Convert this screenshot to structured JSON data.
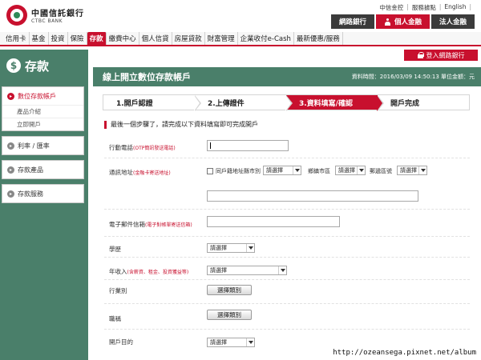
{
  "brand": {
    "name_zh": "中國信託銀行",
    "name_en": "CTBC BANK"
  },
  "util_links": [
    "中信金控",
    "服務據點",
    "English"
  ],
  "brand_tabs": {
    "online_bank": "網路銀行",
    "personal": "個人金融",
    "corporate": "法人金融"
  },
  "main_nav": [
    "信用卡",
    "基金",
    "投資",
    "保險",
    "存款",
    "繳費中心",
    "個人信貸",
    "房屋貸款",
    "財富管理",
    "企業收付e-Cash",
    "最新優惠/服務"
  ],
  "main_nav_active": "存款",
  "login_button": "登入網路銀行",
  "sidebar": {
    "title": "存款",
    "groups": [
      {
        "label": "數位存款帳戶",
        "sub": [
          "產品介紹",
          "立即開戶"
        ]
      },
      {
        "label": "利率 / 匯率",
        "sub": []
      },
      {
        "label": "存款產品",
        "sub": []
      },
      {
        "label": "存款服務",
        "sub": []
      }
    ]
  },
  "content": {
    "title": "線上開立數位存款帳戶",
    "meta": "資料時間：2016/03/09 14:50:13 單位金額：元",
    "steps": [
      "1.開戶認證",
      "2.上傳證件",
      "3.資料填寫/確認",
      "開戶完成"
    ],
    "active_step": 2,
    "notice": "最後一個步驟了，請完成以下資料填寫即可完成開戶"
  },
  "form": {
    "mobile": {
      "label": "行動電話",
      "hint": "(OTP簡訊發送電話)",
      "value": ""
    },
    "address": {
      "label": "通訊地址",
      "hint": "(金融卡寄送地址)",
      "same_as_registered": "同戶籍地址",
      "city_label": "縣市別",
      "district_label": "鄉鎮市區",
      "zip_label": "郵遞區號",
      "select_placeholder": "請選擇",
      "street_value": ""
    },
    "email": {
      "label": "電子郵件信箱",
      "hint": "(電子對帳單寄送信箱)",
      "value": ""
    },
    "education": {
      "label": "學歷",
      "value": "請選擇"
    },
    "income": {
      "label": "年收入",
      "hint": "(含薪資、租金、投資獲益等)",
      "value": "請選擇"
    },
    "industry": {
      "label": "行業別",
      "button": "選擇類別"
    },
    "position": {
      "label": "職稱",
      "button": "選擇類別"
    },
    "purpose": {
      "label": "開戶目的",
      "value": "請選擇"
    }
  },
  "watermark": "http://ozeansega.pixnet.net/album",
  "colors": {
    "brand_red": "#c8102e",
    "sidebar_green": "#4a7f6a"
  }
}
